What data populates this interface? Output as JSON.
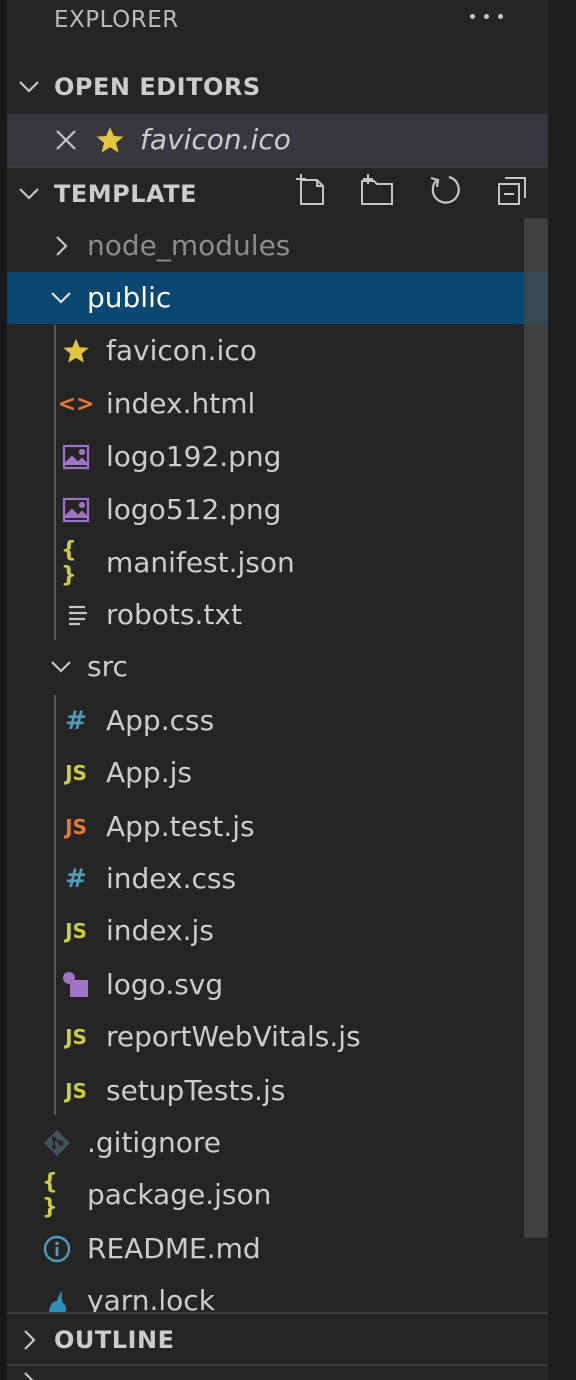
{
  "explorer": {
    "title": "EXPLORER"
  },
  "open_editors": {
    "label": "OPEN EDITORS",
    "items": [
      {
        "name": "favicon.ico",
        "icon": "star-icon"
      }
    ]
  },
  "workspace": {
    "label": "TEMPLATE"
  },
  "toolbar": {
    "new_file": "new-file-icon",
    "new_folder": "new-folder-icon",
    "refresh": "refresh-icon",
    "collapse": "collapse-all-icon"
  },
  "tree": [
    {
      "name": "node_modules",
      "type": "folder",
      "expanded": false
    },
    {
      "name": "public",
      "type": "folder",
      "expanded": true,
      "selected": true
    },
    {
      "name": "favicon.ico",
      "icon": "star-icon"
    },
    {
      "name": "index.html",
      "icon": "html-icon",
      "glyph": "<>"
    },
    {
      "name": "logo192.png",
      "icon": "image-icon"
    },
    {
      "name": "logo512.png",
      "icon": "image-icon"
    },
    {
      "name": "manifest.json",
      "icon": "json-icon",
      "glyph": "{ }"
    },
    {
      "name": "robots.txt",
      "icon": "text-lines-icon"
    },
    {
      "name": "src",
      "type": "folder",
      "expanded": true
    },
    {
      "name": "App.css",
      "icon": "css-hash-icon",
      "glyph": "#"
    },
    {
      "name": "App.js",
      "icon": "js-icon",
      "glyph": "JS"
    },
    {
      "name": "App.test.js",
      "icon": "js-test-icon",
      "glyph": "JS"
    },
    {
      "name": "index.css",
      "icon": "css-hash-icon",
      "glyph": "#"
    },
    {
      "name": "index.js",
      "icon": "js-icon",
      "glyph": "JS"
    },
    {
      "name": "logo.svg",
      "icon": "svg-icon"
    },
    {
      "name": "reportWebVitals.js",
      "icon": "js-icon",
      "glyph": "JS"
    },
    {
      "name": "setupTests.js",
      "icon": "js-icon",
      "glyph": "JS"
    },
    {
      "name": ".gitignore",
      "icon": "git-icon"
    },
    {
      "name": "package.json",
      "icon": "json-icon",
      "glyph": "{ }"
    },
    {
      "name": "README.md",
      "icon": "info-icon",
      "glyph": "i"
    },
    {
      "name": "yarn.lock",
      "icon": "yarn-icon"
    }
  ],
  "outline": {
    "label": "OUTLINE"
  },
  "colors": {
    "selected_row": "#094771",
    "js": "#cbcb41",
    "js_test": "#e37933",
    "css": "#519aba",
    "html": "#e37933",
    "image": "#a074c4",
    "json": "#cbcb41",
    "star": "#e2c541",
    "info": "#519aba"
  }
}
